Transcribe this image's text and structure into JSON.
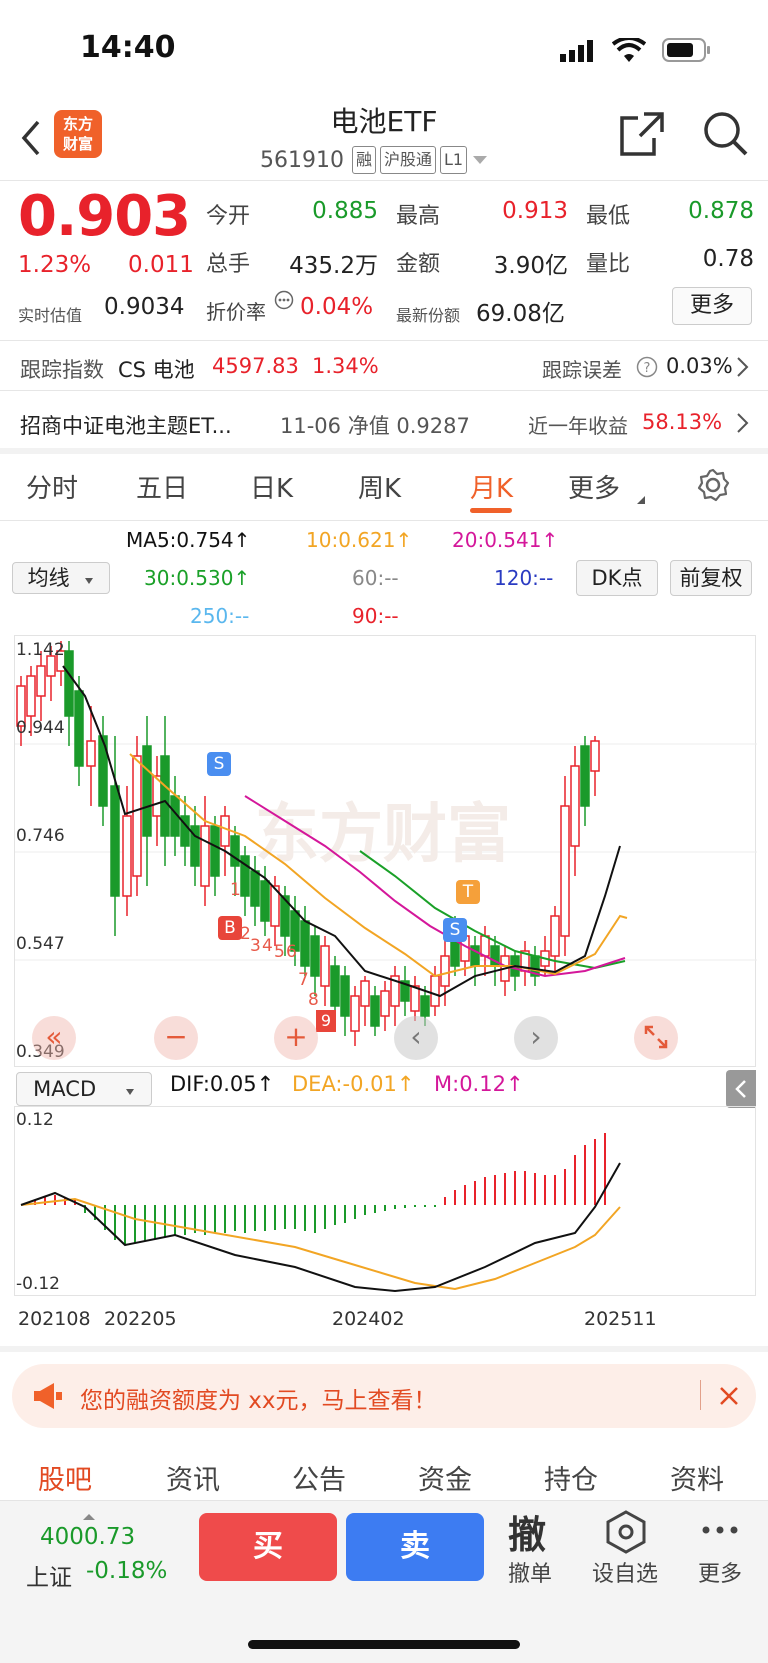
{
  "status": {
    "time": "14:40"
  },
  "header": {
    "title": "电池ETF",
    "code": "561910",
    "tags": [
      "融",
      "沪股通",
      "L1"
    ],
    "logo_text": "东方财富"
  },
  "quote": {
    "price": "0.903",
    "change_pct": "1.23%",
    "change": "0.011",
    "est_label": "实时估值",
    "est_value": "0.9034",
    "fields": [
      {
        "label": "今开",
        "value": "0.885",
        "color": "#1a9a2a"
      },
      {
        "label": "最高",
        "value": "0.913",
        "color": "#e8222b"
      },
      {
        "label": "最低",
        "value": "0.878",
        "color": "#1a9a2a"
      },
      {
        "label": "总手",
        "value": "435.2万",
        "color": "#222222"
      },
      {
        "label": "金额",
        "value": "3.90亿",
        "color": "#222222"
      },
      {
        "label": "量比",
        "value": "0.78",
        "color": "#222222"
      }
    ],
    "premium_label": "折价率",
    "premium_value": "0.04%",
    "shares_label": "最新份额",
    "shares_value": "69.08亿",
    "more": "更多"
  },
  "tracking": {
    "label": "跟踪指数",
    "index_name": "CS 电池",
    "index_value": "4597.83",
    "index_pct": "1.34%",
    "error_label": "跟踪误差",
    "error_value": "0.03%"
  },
  "fund": {
    "name": "招商中证电池主题ET...",
    "nav_text": "11-06 净值 0.9287",
    "ret_label": "近一年收益",
    "ret_value": "58.13%"
  },
  "tabs": [
    "分时",
    "五日",
    "日K",
    "周K",
    "月K",
    "更多"
  ],
  "active_tab": "月K",
  "ma": {
    "ma5": "MA5:0.754↑",
    "ma10": "10:0.621↑",
    "ma20": "20:0.541↑",
    "ma30": "30:0.530↑",
    "ma60": "60:--",
    "ma120": "120:--",
    "ma250": "250:--",
    "ma90": "90:--",
    "selector": "均线",
    "dk": "DK点",
    "fq": "前复权"
  },
  "chart_data": {
    "type": "candlestick",
    "y_ticks": [
      "1.142",
      "0.944",
      "0.746",
      "0.547",
      "0.349"
    ],
    "x_ticks": [
      "202108",
      "202205",
      "202402",
      "202511"
    ],
    "watermark": "东方财富",
    "signal_labels": [
      "S",
      "S",
      "B",
      "T"
    ],
    "signal_numbers": [
      "1",
      "2",
      "3",
      "4",
      "5",
      "6",
      "7",
      "8",
      "9"
    ]
  },
  "macd": {
    "selector": "MACD",
    "dif": "DIF:0.05↑",
    "dea": "DEA:-0.01↑",
    "m": "M:0.12↑",
    "top": "0.12",
    "bottom": "-0.12"
  },
  "banner": {
    "text": "您的融资额度为 xx元，马上查看！"
  },
  "bottom_tabs": [
    "股吧",
    "资讯",
    "公告",
    "资金",
    "持仓",
    "资料"
  ],
  "bottom": {
    "index_value": "4000.73",
    "index_name": "上证",
    "index_pct": "-0.18%",
    "buy": "买",
    "sell": "卖",
    "cancel_icon": "撤",
    "cancel": "撤单",
    "watch": "设自选",
    "more": "更多"
  }
}
